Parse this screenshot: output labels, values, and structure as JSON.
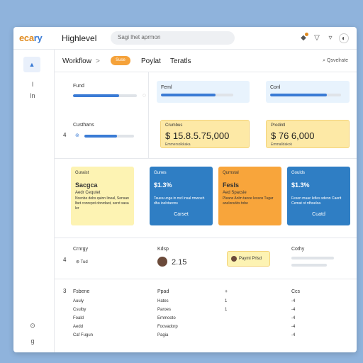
{
  "topbar": {
    "logo_a": "eca",
    "logo_b": "ry",
    "app_title": "Highlevel",
    "search_placeholder": "Sagi lhet aprmon",
    "icons": [
      "bell-icon",
      "filter-icon",
      "filter-down-icon",
      "avatar-icon"
    ]
  },
  "nav": {
    "crumb1": "Workflow",
    "separator": ">",
    "pill": "Suse",
    "tab1": "Poylat",
    "tab2": "Teratls",
    "right_label": "Qsvelrate"
  },
  "rail": {
    "item2": "l",
    "item3": "ln",
    "bottom1": "⊙",
    "bottom2": "g"
  },
  "stats": {
    "left_label": "Fund",
    "left_progress": 0.72,
    "card1_label": "Feml",
    "card1_progress": 0.75,
    "card2_label": "Conl",
    "card2_progress": 0.8,
    "left2_label": "Custhans",
    "left2_icon": "sync-icon",
    "left2_progress": 0.65,
    "row_num": "4",
    "card3_label": "Crumbus",
    "card3_value": "$ 15.8.5.75,000",
    "card3_sub": "Emmersolkkaka",
    "card4_label": "Prodintl",
    "card4_value": "$ 76 6,000",
    "card4_sub": "Emmalldakok"
  },
  "tiles": [
    {
      "t1": "Guraist",
      "t2": "Sacgca",
      "t3": "Aedr Cequtet",
      "t4": "Ncenbe debs quinn lineal, Sensan lbet conrepot obnrdaot, serxt sasa ler",
      "cta": "",
      "bg": "#fdf3b3",
      "fg": "#333"
    },
    {
      "t1": "Gunes",
      "t2": "$1.3%",
      "t3": "",
      "t4": "Tauea unga in mcl insal rmwoeh dha ioelvtarons",
      "cta": "Carset",
      "bg": "#2f7ec4",
      "fg": "#fff"
    },
    {
      "t1": "Qurnstal",
      "t2": "Fesls",
      "t3": "Aed Spacsie",
      "t4": "Pleans Anlm tanoe lessos Tugar anelorarkts tobe",
      "cta": "",
      "bg": "#f8a53b",
      "fg": "#333"
    },
    {
      "t1": "Goulds",
      "t2": "$1.3%",
      "t3": "",
      "t4": "Fesen muac lefies sdenn Caerit Cemat ot rdhoeloa",
      "cta": "Cuatd",
      "bg": "#2f7ec4",
      "fg": "#fff"
    }
  ],
  "mid": {
    "col1_label": "Crnrgy",
    "col1_num": "4",
    "col1_sub": "Tud",
    "col2_label": "Kdsp",
    "col2_value": "2.15",
    "chip_label": "Paymi Prlsd",
    "col4_label": "Cothy"
  },
  "table": {
    "row_num": "3",
    "headers": [
      "Fsbene",
      "Ppad",
      "+",
      "Ccs"
    ],
    "rows": [
      [
        "Auuly",
        "Hates",
        "1",
        "-4"
      ],
      [
        "Csulby",
        "Paroes",
        "1",
        "-4"
      ],
      [
        "Foald",
        "Emmooto",
        "",
        "-4"
      ],
      [
        "Aedd",
        "Foovadorp",
        "",
        "-4"
      ],
      [
        "Caf Fugun",
        "Pagia",
        "",
        "-4"
      ]
    ]
  }
}
